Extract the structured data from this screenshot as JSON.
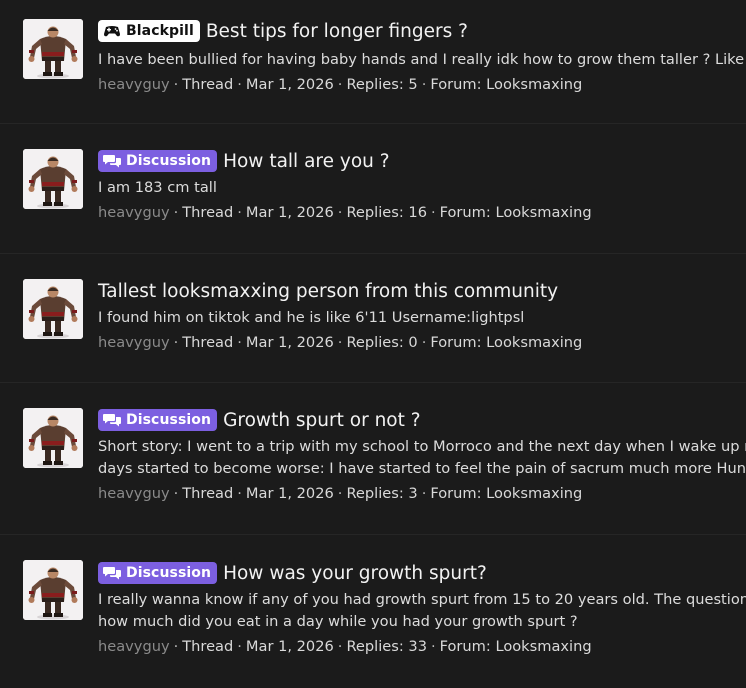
{
  "threads": [
    {
      "badge": "Blackpill",
      "title": "Best tips for longer fingers ?",
      "snippet": [
        "I have been bullied for having baby hands and I really idk how to grow them taller ? Like st"
      ],
      "author": "heavyguy",
      "type": "Thread",
      "date": "Mar 1, 2026",
      "replies": "Replies: 5",
      "forum": "Forum: Looksmaxing"
    },
    {
      "badge": "Discussion",
      "title": "How tall are you ?",
      "snippet": [
        "I am 183 cm tall"
      ],
      "author": "heavyguy",
      "type": "Thread",
      "date": "Mar 1, 2026",
      "replies": "Replies: 16",
      "forum": "Forum: Looksmaxing"
    },
    {
      "badge": "",
      "title": "Tallest looksmaxxing person from this community",
      "snippet": [
        "I found him on tiktok and he is like 6'11 Username:lightpsl"
      ],
      "author": "heavyguy",
      "type": "Thread",
      "date": "Mar 1, 2026",
      "replies": "Replies: 0",
      "forum": "Forum: Looksmaxing"
    },
    {
      "badge": "Discussion",
      "title": "Growth spurt or not ?",
      "snippet": [
        "Short story: I went to a trip with my school to Morroco and the next day when I wake up m",
        "days started to become worse: I have started to feel the pain of sacrum much more Hungri"
      ],
      "author": "heavyguy",
      "type": "Thread",
      "date": "Mar 1, 2026",
      "replies": "Replies: 3",
      "forum": "Forum: Looksmaxing"
    },
    {
      "badge": "Discussion",
      "title": "How was your growth spurt?",
      "snippet": [
        "I really wanna know if any of you had growth spurt from 15 to 20 years old. The question I",
        "how much did you eat in a day while you had your growth spurt ?"
      ],
      "author": "heavyguy",
      "type": "Thread",
      "date": "Mar 1, 2026",
      "replies": "Replies: 33",
      "forum": "Forum: Looksmaxing"
    }
  ],
  "separator": "·",
  "colors": {
    "discussion_badge": "#7c5fe0",
    "blackpill_badge": "#ffffff",
    "background": "#1b1b1b",
    "author": "#8a8a8a"
  },
  "icons": {
    "discussion": "chat-bubbles-icon",
    "blackpill": "gamepad-icon",
    "avatar": "heavy-character-avatar"
  }
}
